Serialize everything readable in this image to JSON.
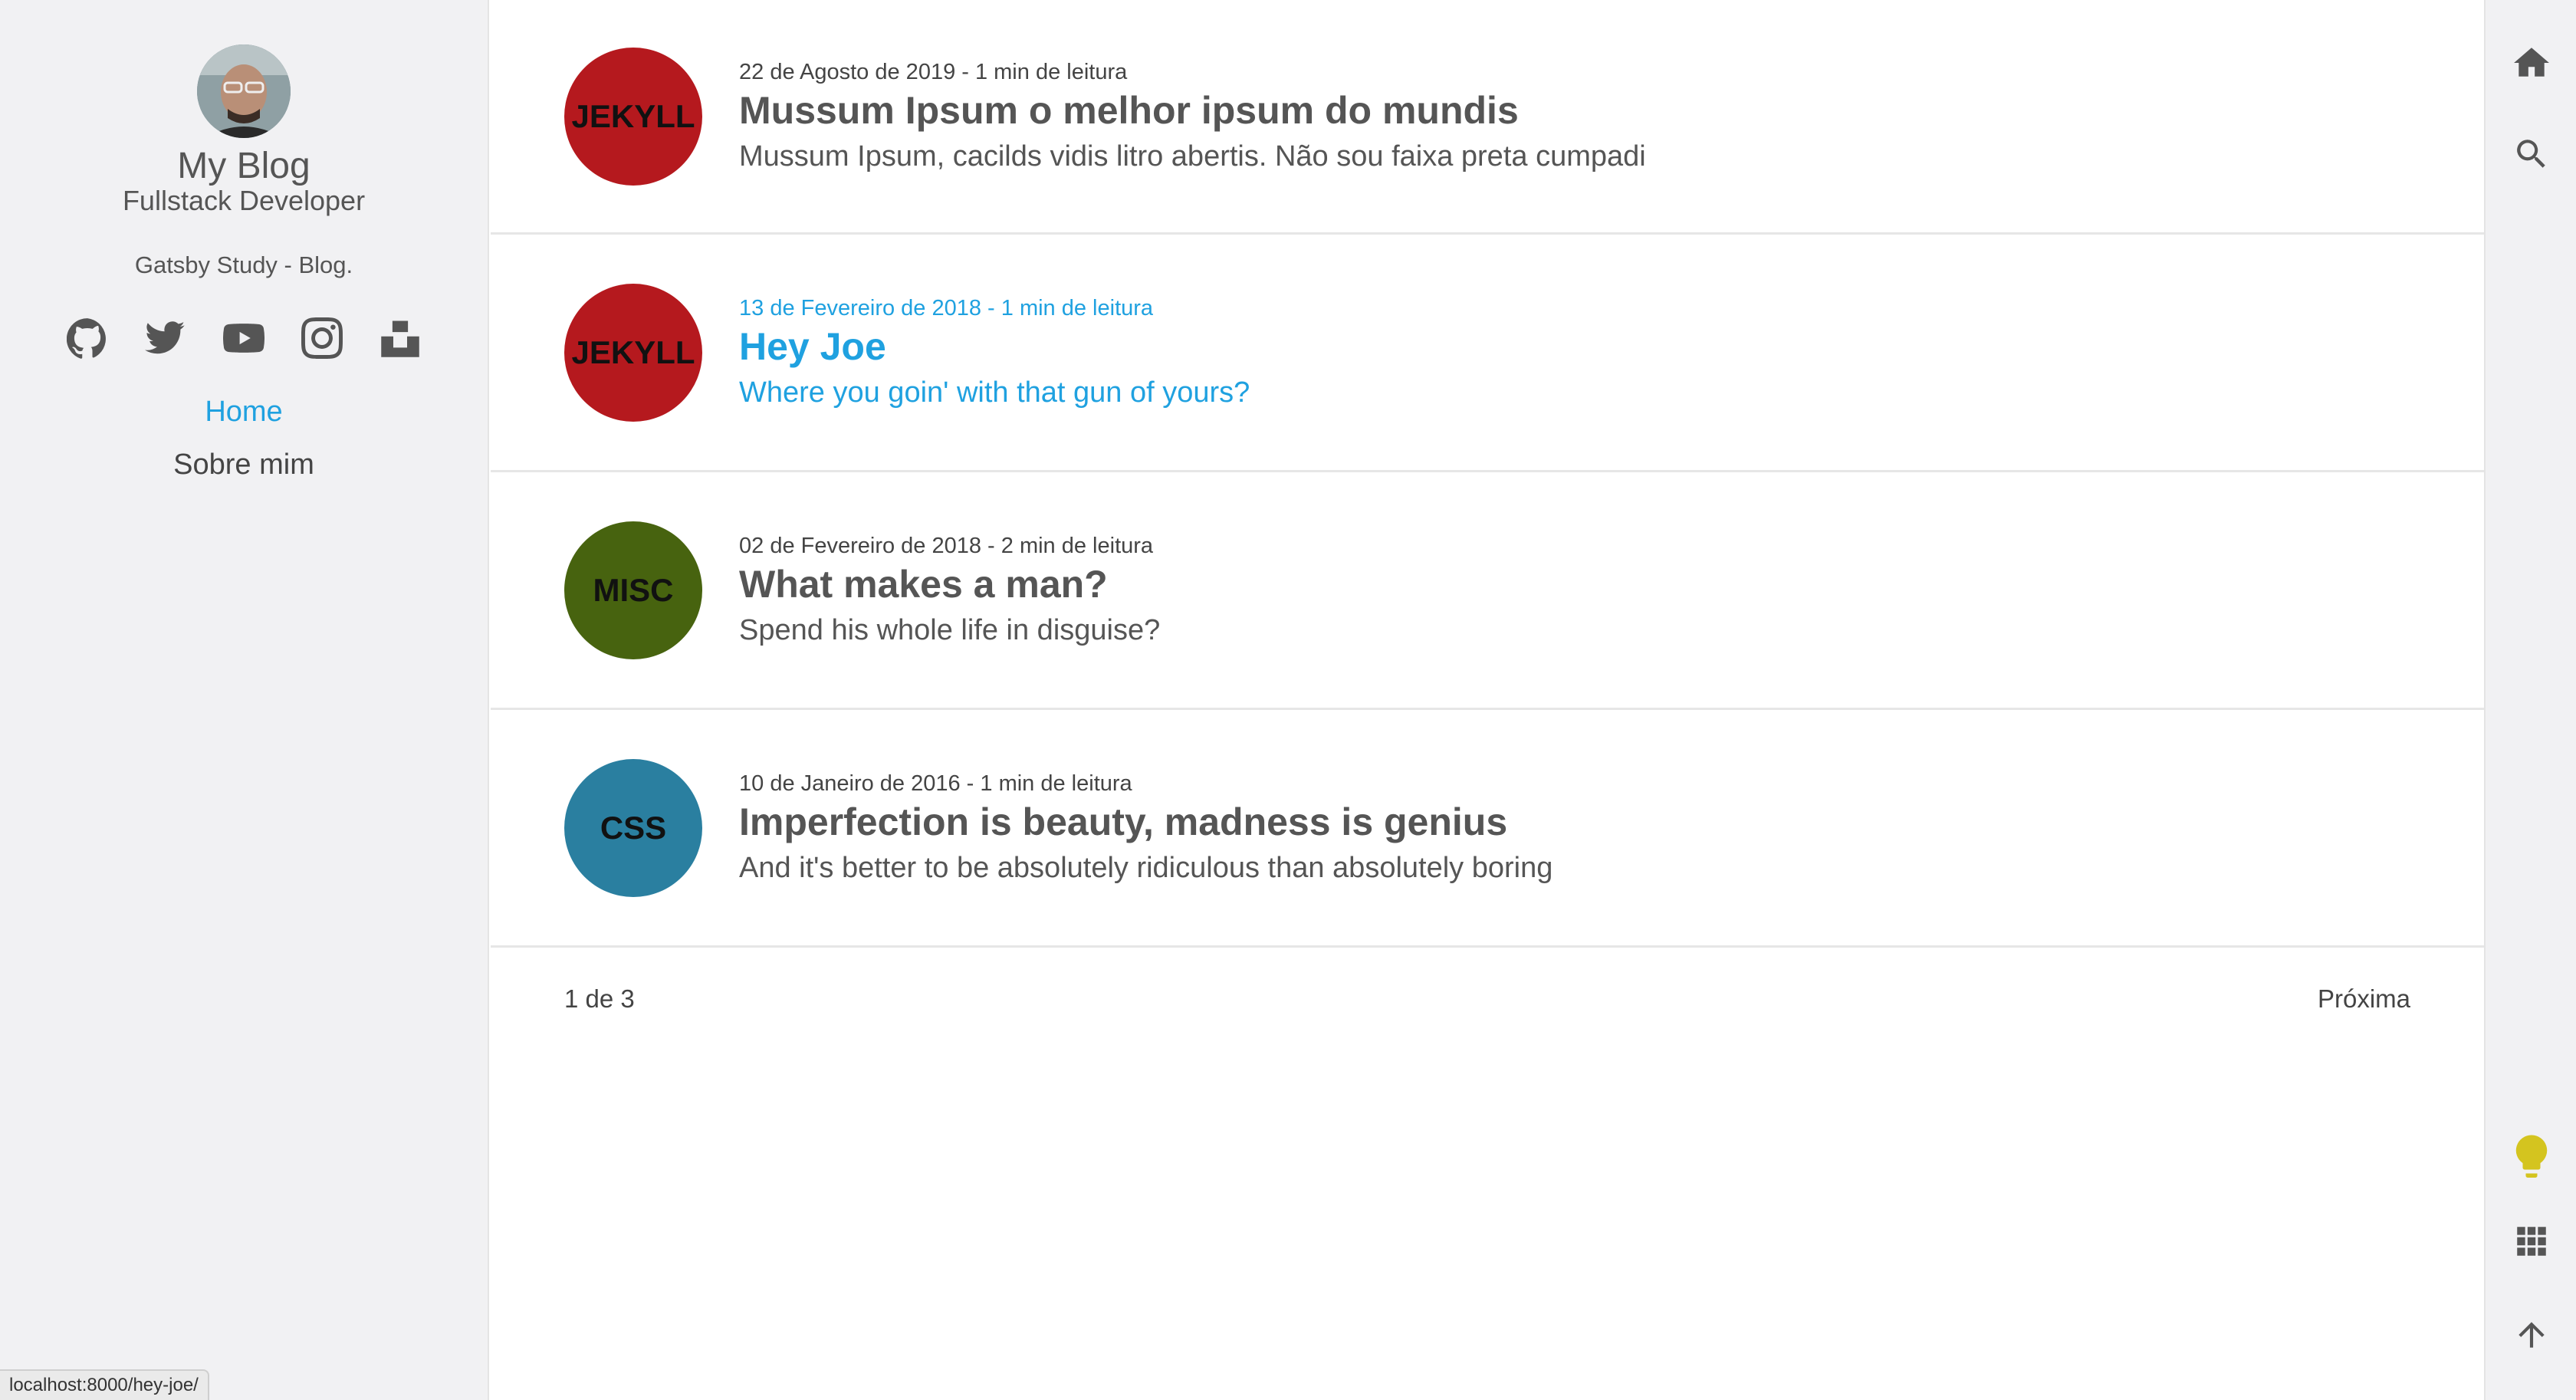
{
  "sidebar": {
    "title": "My Blog",
    "subtitle": "Fullstack Developer",
    "description": "Gatsby Study - Blog.",
    "social": [
      "github-icon",
      "twitter-icon",
      "youtube-icon",
      "instagram-icon",
      "unsplash-icon"
    ],
    "nav": [
      {
        "label": "Home",
        "active": true
      },
      {
        "label": "Sobre mim",
        "active": false
      }
    ]
  },
  "posts": [
    {
      "tag": "JEKYLL",
      "tag_color": "#b5191e",
      "date": "22 de Agosto de 2019 - 1 min de leitura",
      "title": "Mussum Ipsum o melhor ipsum do mundis",
      "description": "Mussum Ipsum, cacilds vidis litro abertis. Não sou faixa preta cumpadi"
    },
    {
      "tag": "JEKYLL",
      "tag_color": "#b5191e",
      "date": "13 de Fevereiro de 2018 - 1 min de leitura",
      "title": "Hey Joe",
      "description": "Where you goin' with that gun of yours?",
      "hovered": true
    },
    {
      "tag": "MISC",
      "tag_color": "#47630f",
      "date": "02 de Fevereiro de 2018 - 2 min de leitura",
      "title": "What makes a man?",
      "description": "Spend his whole life in disguise?"
    },
    {
      "tag": "CSS",
      "tag_color": "#2a7fa0",
      "date": "10 de Janeiro de 2016 - 1 min de leitura",
      "title": "Imperfection is beauty, madness is genius",
      "description": "And it's better to be absolutely ridiculous than absolutely boring"
    }
  ],
  "pagination": {
    "current": "1 de 3",
    "next": "Próxima"
  },
  "rightbar": {
    "top_icons": [
      "home-icon",
      "search-icon"
    ],
    "bottom_icons": [
      "lightbulb-icon",
      "grid-icon",
      "arrow-up-icon"
    ],
    "lightbulb_color": "#d4c41f"
  },
  "status_url": "localhost:8000/hey-joe/"
}
